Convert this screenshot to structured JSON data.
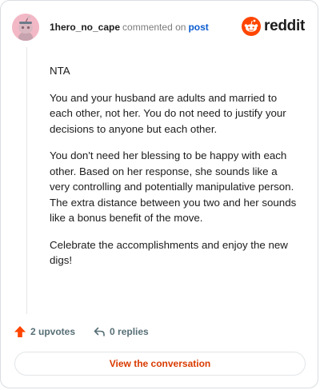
{
  "comment": {
    "author": "1hero_no_cape",
    "action_text": "commented on",
    "post_link": "post",
    "paragraphs": [
      "NTA",
      "You and your husband are adults and married to each other, not her. You do not need to justify your decisions to anyone but each other.",
      "You don't need her blessing to be happy with each other. Based on her response, she sounds like a very controlling and potentially manipulative person. The extra distance between you two and her sounds like a bonus benefit of the move.",
      "Celebrate the accomplishments and enjoy the new digs!"
    ]
  },
  "brand": {
    "name": "reddit",
    "color": "#ff4500"
  },
  "actions": {
    "upvotes": "2 upvotes",
    "replies": "0 replies",
    "upvote_color": "#ff4500"
  },
  "footer": {
    "view_label": "View the conversation"
  },
  "icons": {
    "avatar": "snoo-avatar-icon",
    "logo": "reddit-snoo-icon",
    "upvote": "upvote-arrow-icon",
    "reply": "reply-arrow-icon"
  }
}
